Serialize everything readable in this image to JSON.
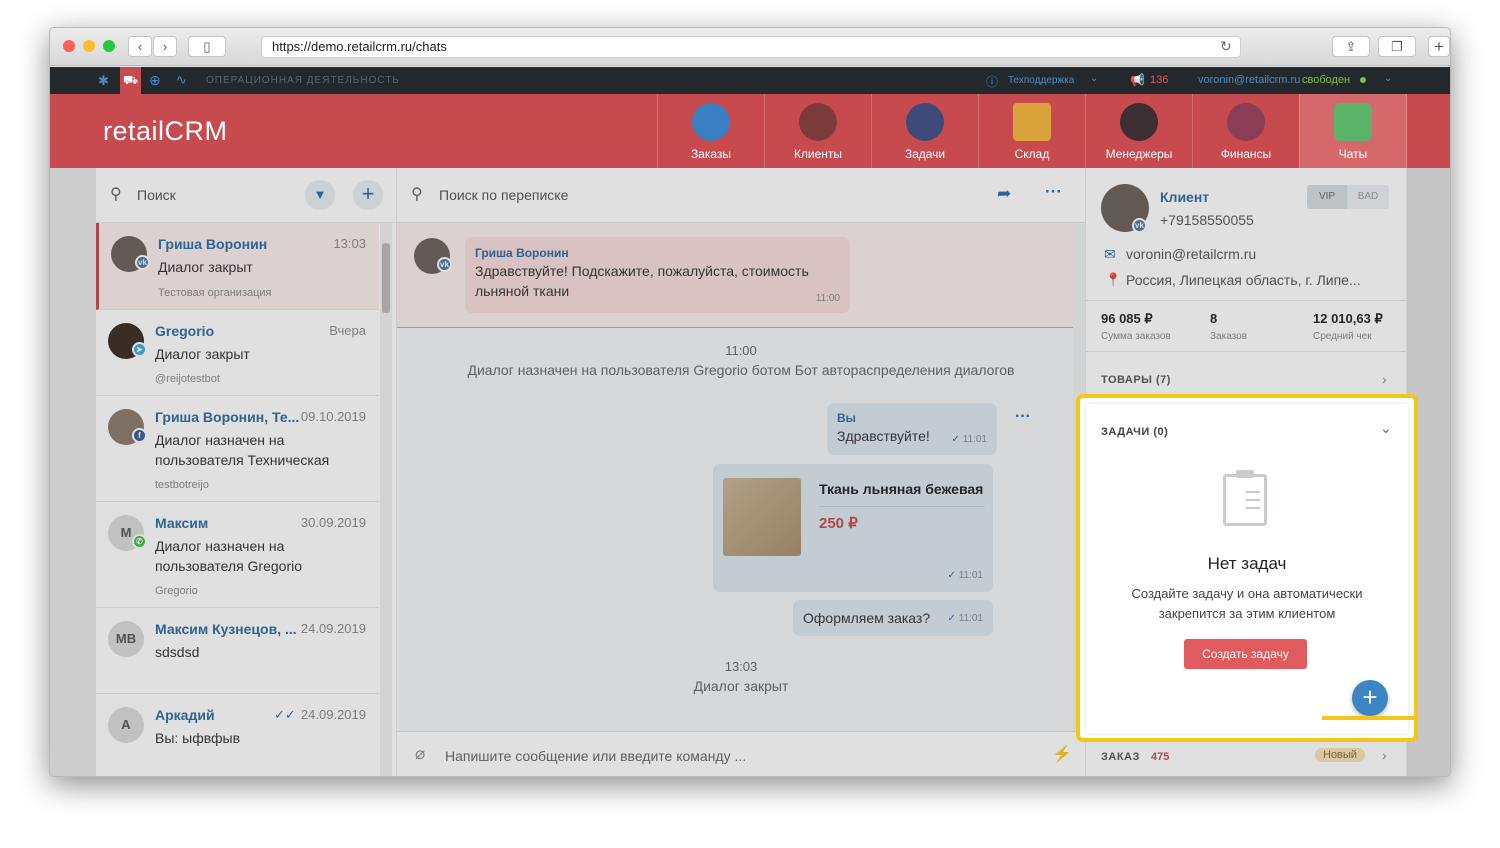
{
  "browser": {
    "url": "https://demo.retailcrm.ru/chats"
  },
  "topbar": {
    "section": "ОПЕРАЦИОННАЯ ДЕЯТЕЛЬНОСТЬ",
    "support": "Техподдержка",
    "notif_count": "136",
    "user_email": "voronin@retailcrm.ru",
    "user_status": "свободен"
  },
  "header": {
    "logo": "retailCRM",
    "nav": [
      "Заказы",
      "Клиенты",
      "Задачи",
      "Склад",
      "Менеджеры",
      "Финансы",
      "Чаты"
    ]
  },
  "chat_list": {
    "search_placeholder": "Поиск",
    "items": [
      {
        "name": "Гриша Воронин",
        "time": "13:03",
        "text": "Диалог закрыт",
        "sub": "Тестовая организация",
        "channel": "vk"
      },
      {
        "name": "Gregorio",
        "time": "Вчера",
        "text": "Диалог закрыт",
        "sub": "@reijotestbot",
        "channel": "telegram"
      },
      {
        "name": "Гриша Воронин, Те...",
        "time": "09.10.2019",
        "text": "Диалог назначен на пользователя Техническая",
        "sub": "testbotreijo",
        "channel": "facebook"
      },
      {
        "name": "Максим",
        "time": "30.09.2019",
        "text": "Диалог назначен на пользователя Gregorio",
        "sub": "Gregorio",
        "initials": "M",
        "channel": "whatsapp"
      },
      {
        "name": "Максим Кузнецов, ...",
        "time": "24.09.2019",
        "text": "sdsdsd",
        "initials": "MB"
      },
      {
        "name": "Аркадий",
        "time": "24.09.2019",
        "text": "Вы: ыфвфыв",
        "initials": "A"
      }
    ]
  },
  "conversation": {
    "search_placeholder": "Поиск по переписке",
    "incoming": {
      "author": "Гриша Воронин",
      "text": "Здравствуйте! Подскажите, пожалуйста, стоимость льняной ткани",
      "time": "11:00"
    },
    "system1": {
      "time": "11:00",
      "text": "Диалог назначен на пользователя Gregorio ботом Бот автораспределения диалогов"
    },
    "out1": {
      "author": "Вы",
      "text": "Здравствуйте!",
      "time": "11:01"
    },
    "product": {
      "name": "Ткань льняная бежевая",
      "price": "250 ₽",
      "time": "11:01"
    },
    "out2": {
      "text": "Оформляем заказ?",
      "time": "11:01"
    },
    "system2": {
      "time": "13:03",
      "text": "Диалог закрыт"
    },
    "input_placeholder": "Напишите сообщение или введите команду ..."
  },
  "client": {
    "label": "Клиент",
    "phone": "+79158550055",
    "tag_vip": "VIP",
    "tag_bad": "BAD",
    "email": "voronin@retailcrm.ru",
    "address": "Россия, Липецкая область, г. Липе...",
    "stats": [
      {
        "value": "96 085 ₽",
        "label": "Сумма заказов"
      },
      {
        "value": "8",
        "label": "Заказов"
      },
      {
        "value": "12 010,63 ₽",
        "label": "Средний чек"
      }
    ],
    "goods": "ТОВАРЫ (7)",
    "tasks": {
      "title": "ЗАДАЧИ (0)",
      "empty_title": "Нет задач",
      "empty_text": "Создайте задачу и она автоматически закрепится за этим клиентом",
      "create_button": "Создать задачу"
    },
    "order": {
      "label": "ЗАКАЗ",
      "number": "475",
      "status": "Новый"
    }
  },
  "colors": {
    "brand": "#c64a4e",
    "highlight": "#f5c518",
    "link": "#2d6aa3"
  }
}
